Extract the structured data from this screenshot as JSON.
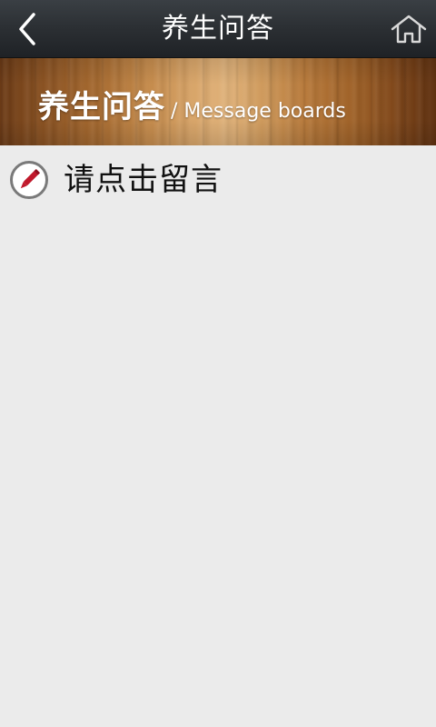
{
  "header": {
    "title": "养生问答",
    "back_icon": "back-arrow-icon",
    "home_icon": "home-icon"
  },
  "banner": {
    "title_cn": "养生问答",
    "title_en": "/ Message boards"
  },
  "message_entry": {
    "label": "请点击留言",
    "icon": "pencil-icon",
    "icon_color": "#c0182b"
  }
}
